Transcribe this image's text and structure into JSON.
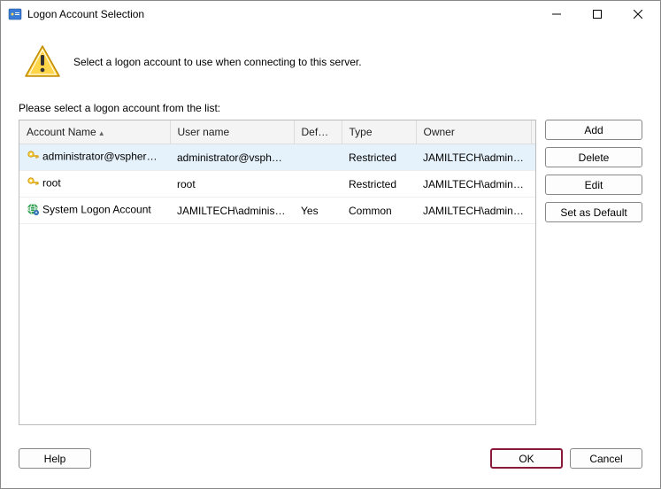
{
  "window": {
    "title": "Logon Account Selection"
  },
  "header": {
    "text": "Select a logon account to use when connecting to this server."
  },
  "listLabel": "Please select a logon account from the list:",
  "columns": {
    "accountName": "Account Name",
    "userName": "User name",
    "default": "Default",
    "type": "Type",
    "owner": "Owner"
  },
  "rows": [
    {
      "icon": "key",
      "accountName": "administrator@vsphere.lo",
      "userName": "administrator@vsphe…",
      "default": "",
      "type": "Restricted",
      "owner": "JAMILTECH\\admini…",
      "selected": true
    },
    {
      "icon": "key",
      "accountName": "root",
      "userName": "root",
      "default": "",
      "type": "Restricted",
      "owner": "JAMILTECH\\admini…",
      "selected": false
    },
    {
      "icon": "globe",
      "accountName": "System Logon Account",
      "userName": "JAMILTECH\\administ…",
      "default": "Yes",
      "type": "Common",
      "owner": "JAMILTECH\\admini…",
      "selected": false
    }
  ],
  "sideButtons": {
    "add": "Add",
    "delete": "Delete",
    "edit": "Edit",
    "setDefault": "Set as Default"
  },
  "footer": {
    "help": "Help",
    "ok": "OK",
    "cancel": "Cancel"
  }
}
